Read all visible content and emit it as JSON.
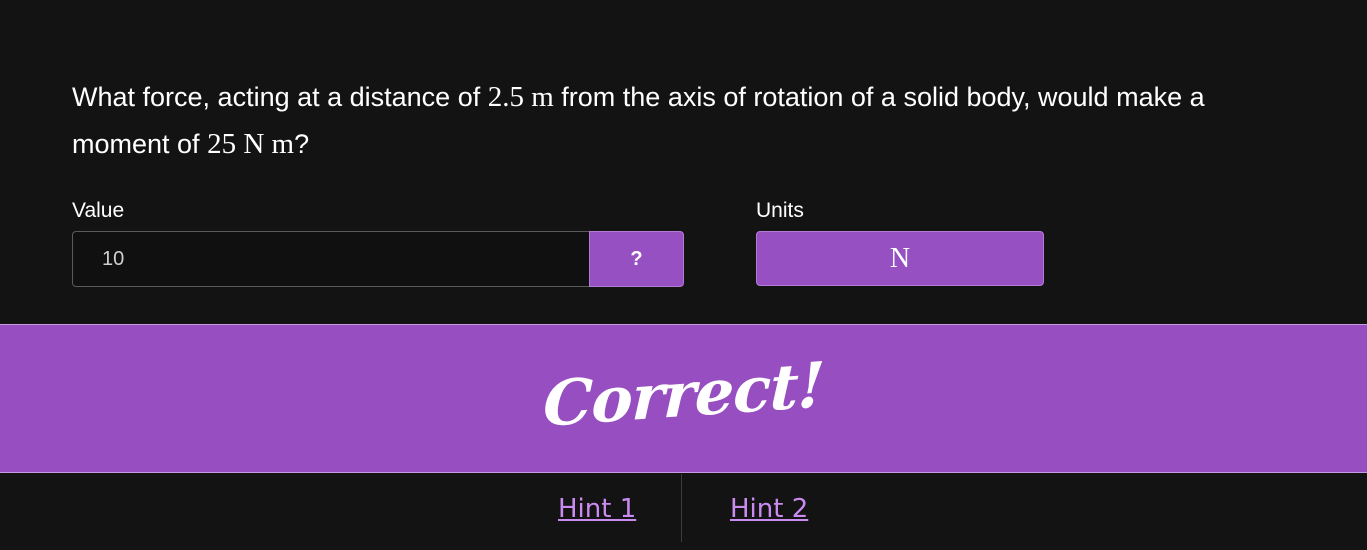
{
  "question": {
    "part1": "What force, acting at a distance of ",
    "distance": "2.5 m",
    "part2": " from the axis of rotation of a solid body, would make a moment of ",
    "moment": "25 N m",
    "part3": "?"
  },
  "value_field": {
    "label": "Value",
    "value": "10",
    "help_label": "?"
  },
  "units_field": {
    "label": "Units",
    "selected": "N"
  },
  "feedback": {
    "message": "Correct!"
  },
  "hints": [
    {
      "label": "Hint 1"
    },
    {
      "label": "Hint 2"
    }
  ],
  "colors": {
    "accent": "#974ec1",
    "background": "#131313",
    "link": "#c98bf0"
  }
}
